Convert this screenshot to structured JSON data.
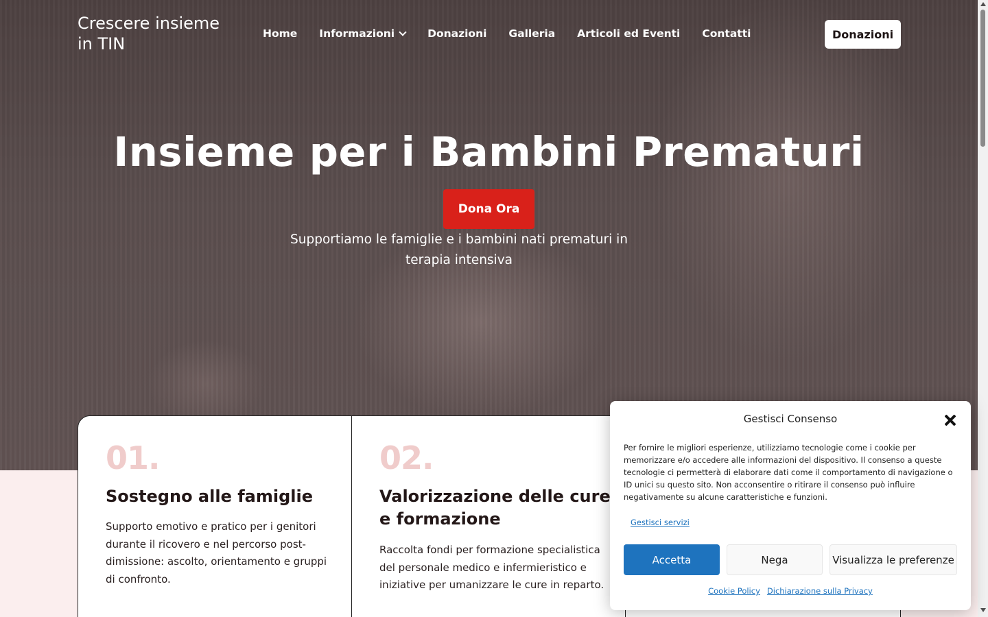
{
  "header": {
    "logo_text": "Crescere insieme in TIN",
    "nav": [
      {
        "label": "Home"
      },
      {
        "label": "Informazioni",
        "has_dropdown": true
      },
      {
        "label": "Donazioni"
      },
      {
        "label": "Galleria"
      },
      {
        "label": "Articoli ed Eventi"
      },
      {
        "label": "Contatti"
      }
    ],
    "cta_label": "Donazioni"
  },
  "hero": {
    "title": "Insieme per i Bambini Prematuri",
    "button_label": "Dona Ora",
    "subtitle": "Supportiamo le famiglie e i bambini nati prematuri in terapia intensiva"
  },
  "cards": [
    {
      "number": "01.",
      "title": "Sostegno alle famiglie",
      "text": "Supporto emotivo e pratico per i genitori durante il ricovero e nel percorso post-dimissione: ascolto, orientamento e gruppi di confronto."
    },
    {
      "number": "02.",
      "title": "Valorizzazione delle cure e formazione",
      "text": "Raccolta fondi per formazione specialistica del personale medico e infermieristico e iniziative per umanizzare le cure in reparto."
    }
  ],
  "cookie_banner": {
    "title": "Gestisci Consenso",
    "text": "Per fornire le migliori esperienze, utilizziamo tecnologie come i cookie per memorizzare e/o accedere alle informazioni del dispositivo. Il consenso a queste tecnologie ci permetterà di elaborare dati come il comportamento di navigazione o ID unici su questo sito. Non acconsentire o ritirare il consenso può influire negativamente su alcune caratteristiche e funzioni.",
    "manage_link": "Gestisci servizi",
    "accept_label": "Accetta",
    "deny_label": "Nega",
    "preferences_label": "Visualizza le preferenze",
    "cookie_policy_link": "Cookie Policy",
    "privacy_link": "Dichiarazione sulla Privacy"
  },
  "colors": {
    "primary_red": "#d9211a",
    "accent_blue": "#1e73be",
    "card_number_pink": "#f0cccb",
    "section_pink": "#fbeeee"
  }
}
